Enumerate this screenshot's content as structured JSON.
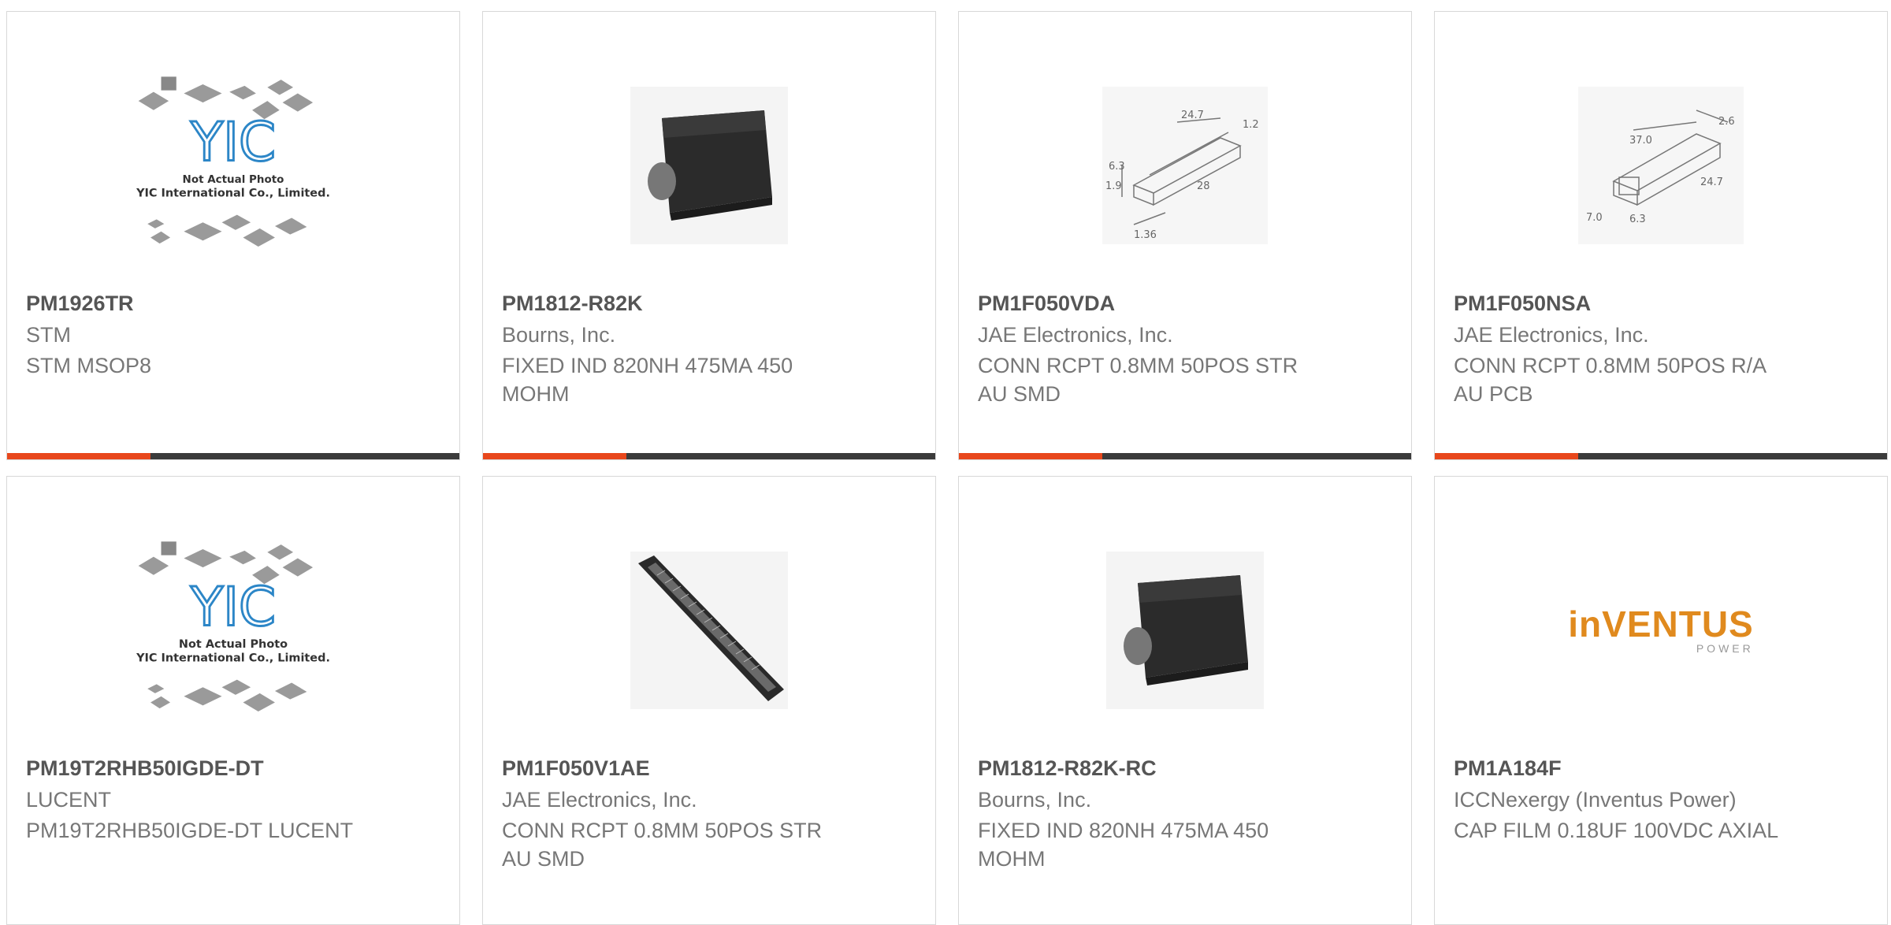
{
  "colors": {
    "accent": "#e8471c",
    "bar": "#3b3b3b",
    "border": "#d8d8d8"
  },
  "yic": {
    "logo_text": "YIC",
    "not_actual": "Not Actual Photo",
    "company": "YIC International Co., Limited."
  },
  "inventus": {
    "word": "inVENTUS",
    "sub": "POWER"
  },
  "products": [
    {
      "part": "PM1926TR",
      "manufacturer": "STM",
      "description": "STM MSOP8",
      "image": "yic-placeholder-icon"
    },
    {
      "part": "PM1812-R82K",
      "manufacturer": "Bourns, Inc.",
      "description": "FIXED IND 820NH 475MA 450 MOHM",
      "image": "inductor-photo"
    },
    {
      "part": "PM1F050VDA",
      "manufacturer": "JAE Electronics, Inc.",
      "description": "CONN RCPT 0.8MM 50POS STR AU SMD",
      "image": "connector-drawing-icon"
    },
    {
      "part": "PM1F050NSA",
      "manufacturer": "JAE Electronics, Inc.",
      "description": "CONN RCPT 0.8MM 50POS R/A AU PCB",
      "image": "connector-drawing-icon"
    },
    {
      "part": "PM19T2RHB50IGDE-DT",
      "manufacturer": "LUCENT",
      "description": "PM19T2RHB50IGDE-DT LUCENT",
      "image": "yic-placeholder-icon"
    },
    {
      "part": "PM1F050V1AE",
      "manufacturer": "JAE Electronics, Inc.",
      "description": "CONN RCPT 0.8MM 50POS STR AU SMD",
      "image": "connector-photo"
    },
    {
      "part": "PM1812-R82K-RC",
      "manufacturer": "Bourns, Inc.",
      "description": "FIXED IND 820NH 475MA 450 MOHM",
      "image": "inductor-photo"
    },
    {
      "part": "PM1A184F",
      "manufacturer": "ICCNexergy (Inventus Power)",
      "description": "CAP FILM 0.18UF 100VDC AXIAL",
      "image": "inventus-logo"
    }
  ],
  "drawing_a": {
    "d1": "24.7",
    "d2": "1.2",
    "d3": "6.3",
    "d4": "1.9",
    "d5": "28",
    "d6": "1.36"
  },
  "drawing_b": {
    "d1": "37.0",
    "d2": "2.6",
    "d3": "24.7",
    "d4": "7.0",
    "d5": "6.3"
  }
}
